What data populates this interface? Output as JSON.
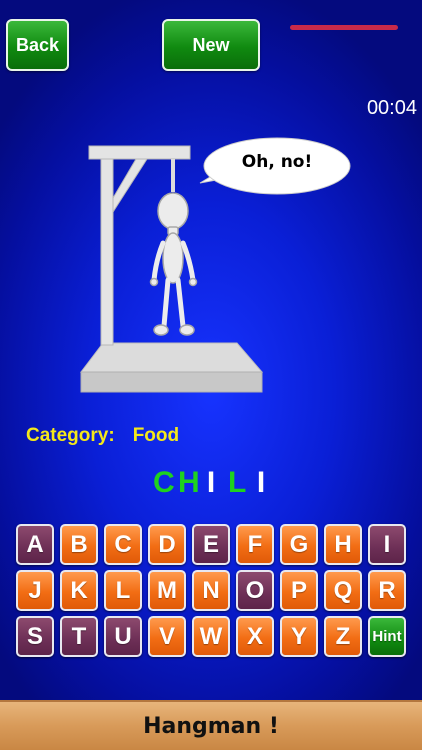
{
  "header": {
    "back_label": "Back",
    "new_label": "New",
    "timer": "00:04",
    "progress_color": "#c82a4a"
  },
  "scene": {
    "speech": "Oh, no!"
  },
  "category": {
    "label": "Category:",
    "value": "Food"
  },
  "word": [
    {
      "char": "C",
      "color": "#1fd11f"
    },
    {
      "char": "H",
      "color": "#1fd11f"
    },
    {
      "char": "I",
      "color": "#ffffff"
    },
    {
      "char": "L",
      "color": "#1fd11f"
    },
    {
      "char": "I",
      "color": "#ffffff"
    }
  ],
  "keyboard": {
    "keys": [
      {
        "label": "A",
        "state": "used"
      },
      {
        "label": "B",
        "state": "available"
      },
      {
        "label": "C",
        "state": "available"
      },
      {
        "label": "D",
        "state": "available"
      },
      {
        "label": "E",
        "state": "used"
      },
      {
        "label": "F",
        "state": "available"
      },
      {
        "label": "G",
        "state": "available"
      },
      {
        "label": "H",
        "state": "available"
      },
      {
        "label": "I",
        "state": "used"
      },
      {
        "label": "J",
        "state": "available"
      },
      {
        "label": "K",
        "state": "available"
      },
      {
        "label": "L",
        "state": "available"
      },
      {
        "label": "M",
        "state": "available"
      },
      {
        "label": "N",
        "state": "available"
      },
      {
        "label": "O",
        "state": "used"
      },
      {
        "label": "P",
        "state": "available"
      },
      {
        "label": "Q",
        "state": "available"
      },
      {
        "label": "R",
        "state": "available"
      },
      {
        "label": "S",
        "state": "used"
      },
      {
        "label": "T",
        "state": "used"
      },
      {
        "label": "U",
        "state": "used"
      },
      {
        "label": "V",
        "state": "available"
      },
      {
        "label": "W",
        "state": "available"
      },
      {
        "label": "X",
        "state": "available"
      },
      {
        "label": "Y",
        "state": "available"
      },
      {
        "label": "Z",
        "state": "available"
      },
      {
        "label": "Hint",
        "state": "hint"
      }
    ],
    "colors": {
      "available": "#f26d14",
      "used": "#6d2f56",
      "hint": "#108a10"
    }
  },
  "footer": {
    "title": "Hangman !"
  }
}
